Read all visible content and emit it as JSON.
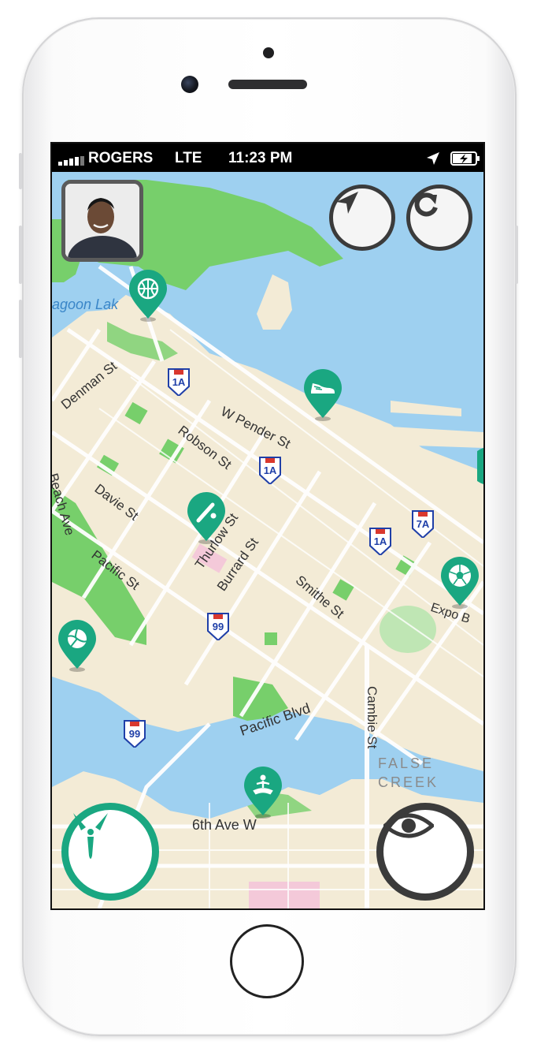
{
  "status_bar": {
    "signal": "▪▪▪▫",
    "carrier": "ROGERS",
    "network": "LTE",
    "time": "11:23 PM"
  },
  "map": {
    "place_labels": {
      "lagoon": "agoon Lak",
      "denman": "Denman St",
      "robson": "Robson St",
      "davie": "Davie St",
      "beach": "Beach Ave",
      "pacific_st": "Pacific St",
      "thurlow": "Thurlow St",
      "burrard": "Burrard St",
      "w_pender": "W Pender St",
      "smithe": "Smithe St",
      "pacific_blvd": "Pacific Blvd",
      "cambie": "Cambie St",
      "false_creek_1": "FALSE",
      "false_creek_2": "CREEK",
      "sixth_ave": "6th Ave W",
      "expo": "Expo B"
    },
    "shields": {
      "s1": "1A",
      "s2": "1A",
      "s3": "1A",
      "s4": "7A",
      "s5": "99",
      "s6": "99"
    },
    "pins": [
      "basketball-pin",
      "shoe-pin",
      "baseball-pin",
      "soccer-pin",
      "volleyball-pin",
      "yoga-pin"
    ]
  },
  "colors": {
    "accent": "#1aa781",
    "water": "#9ed0f0",
    "land": "#f3ebd6",
    "park": "#77cf6b",
    "dark_button": "#3b3b3b"
  }
}
